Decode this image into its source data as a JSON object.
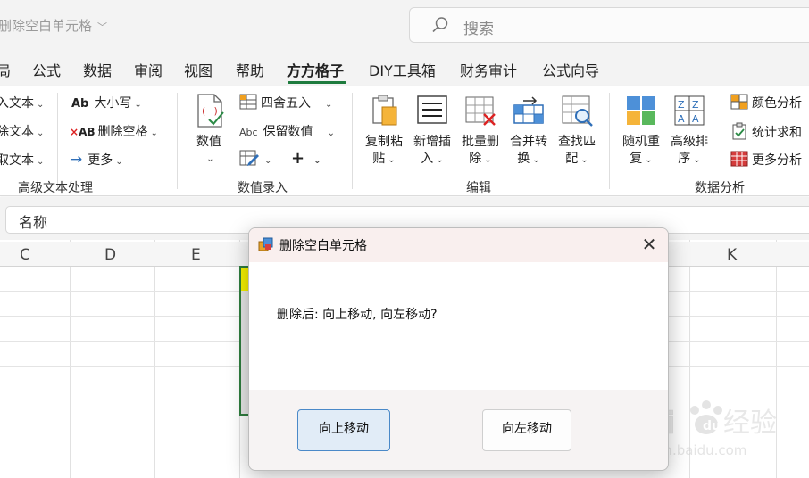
{
  "titlebar": {
    "doc_title": "删除空白单元格",
    "search_placeholder": "搜索"
  },
  "tabs": [
    "局",
    "公式",
    "数据",
    "审阅",
    "视图",
    "帮助",
    "方方格子",
    "DIY工具箱",
    "财务审计",
    "公式向导"
  ],
  "active_tab": "方方格子",
  "ribbon": {
    "text_group": {
      "left_items": [
        "入文本",
        "除文本",
        "取文本"
      ],
      "case_label": "大小写",
      "remove_space_label": "删除空格",
      "more_label": "更多",
      "group_label": "高级文本处理"
    },
    "number_group": {
      "value_label": "数值",
      "round_label": "四舍五入",
      "keep_value_label": "保留数值",
      "group_label": "数值录入"
    },
    "edit_group": {
      "buttons": [
        {
          "line1": "复制粘",
          "line2": "贴"
        },
        {
          "line1": "新增插",
          "line2": "入"
        },
        {
          "line1": "批量删",
          "line2": "除"
        },
        {
          "line1": "合并转",
          "line2": "换"
        },
        {
          "line1": "查找匹",
          "line2": "配"
        }
      ],
      "group_label": "编辑"
    },
    "analysis_group": {
      "buttons": [
        {
          "line1": "随机重",
          "line2": "复"
        },
        {
          "line1": "高级排",
          "line2": "序"
        }
      ],
      "color_analysis": "颜色分析",
      "stats_sum": "统计求和",
      "more_analysis": "更多分析",
      "group_label": "数据分析"
    }
  },
  "formula_bar": {
    "name_box": "名称"
  },
  "columns": [
    "C",
    "D",
    "E",
    "K"
  ],
  "dialog": {
    "title": "删除空白单元格",
    "message": "删除后: 向上移动, 向左移动?",
    "button_up": "向上移动",
    "button_left": "向左移动"
  },
  "watermark": {
    "brand": "Baidu经验",
    "url": "jingyan.baidu.com"
  },
  "colors": {
    "accent_green": "#1e7b3e",
    "selection_yellow": "#f6f100",
    "primary_button_border": "#4a89c8"
  }
}
